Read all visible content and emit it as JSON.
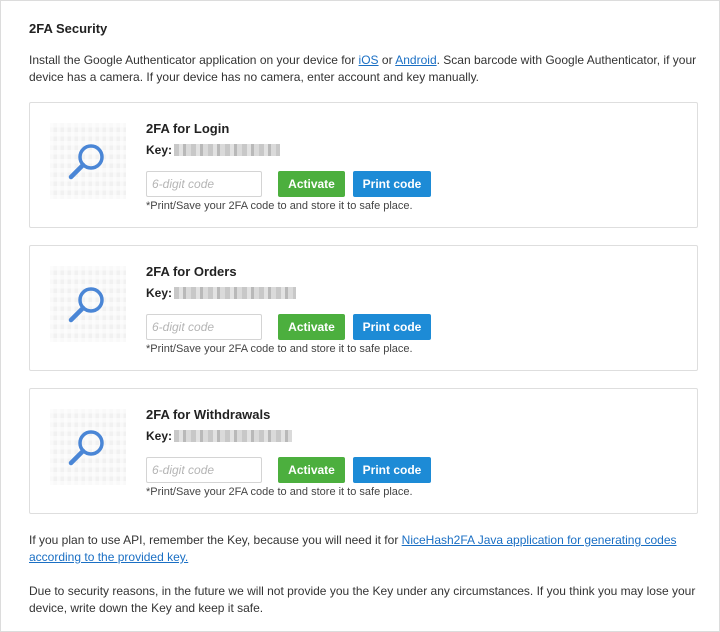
{
  "section_title": "2FA Security",
  "intro": {
    "text_before": "Install the Google Authenticator application on your device for ",
    "ios_link": "iOS",
    "or": " or ",
    "android_link": "Android",
    "text_after": ". Scan barcode with Google Authenticator, if your device has a camera. If your device has no camera, enter account and key manually."
  },
  "cards": [
    {
      "title": "2FA for Login",
      "key_label": "Key:",
      "placeholder": "6-digit code",
      "activate_label": "Activate",
      "print_label": "Print code",
      "note": "*Print/Save your 2FA code to and store it to safe place."
    },
    {
      "title": "2FA for Orders",
      "key_label": "Key:",
      "placeholder": "6-digit code",
      "activate_label": "Activate",
      "print_label": "Print code",
      "note": "*Print/Save your 2FA code to and store it to safe place."
    },
    {
      "title": "2FA for Withdrawals",
      "key_label": "Key:",
      "placeholder": "6-digit code",
      "activate_label": "Activate",
      "print_label": "Print code",
      "note": "*Print/Save your 2FA code to and store it to safe place."
    }
  ],
  "api": {
    "text_before": "If you plan to use API, remember the Key, because you will need it for ",
    "link": "NiceHash2FA Java application for generating codes according to the provided key."
  },
  "security_note": "Due to security reasons, in the future we will not provide you the Key under any circumstances. If you think you may lose your device, write down the Key and keep it safe.",
  "icons": {
    "qr_overlay": "magnifier-icon"
  },
  "colors": {
    "activate": "#4caf3e",
    "print": "#1d8bd6",
    "link": "#1a6fc4",
    "magnifier": "#4a86d6"
  }
}
